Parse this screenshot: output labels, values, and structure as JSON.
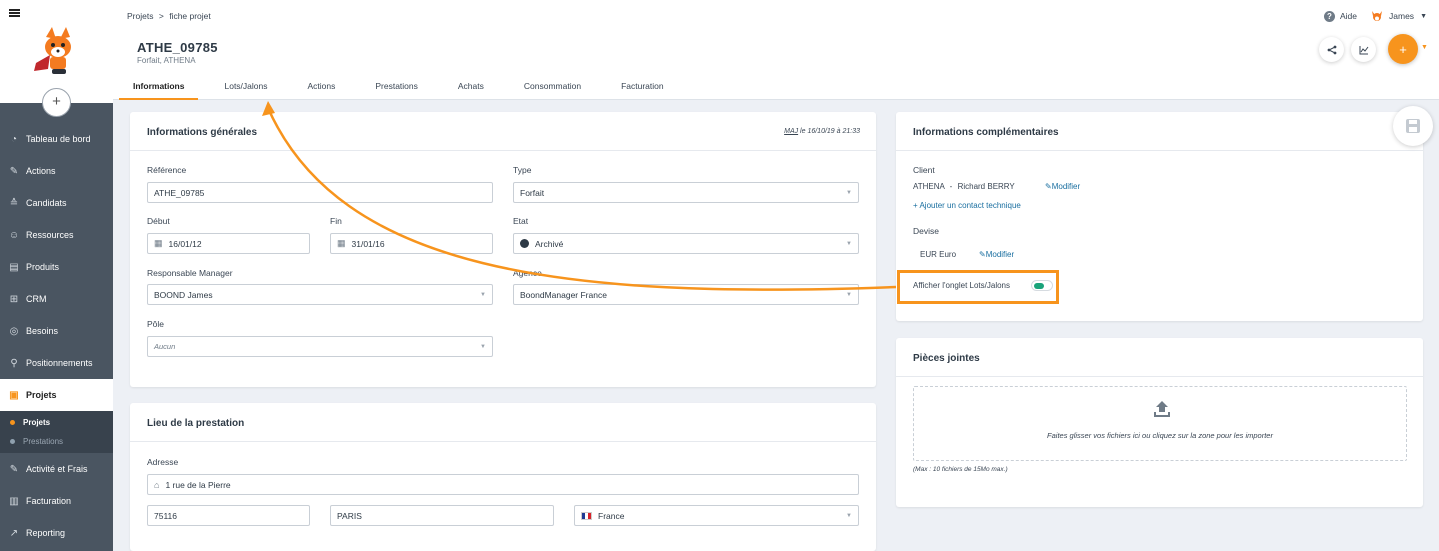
{
  "breadcrumb": {
    "root": "Projets",
    "separator": ">",
    "current": "fiche projet"
  },
  "header": {
    "title": "ATHE_09785",
    "subtitle": "Forfait, ATHENA",
    "help_label": "Aide",
    "user_name": "James",
    "add_label": "+"
  },
  "sidebar": {
    "add_label": "+",
    "items": [
      {
        "label": "Tableau de bord",
        "icon": "dashboard-icon"
      },
      {
        "label": "Actions",
        "icon": "edit-icon"
      },
      {
        "label": "Candidats",
        "icon": "graduation-icon"
      },
      {
        "label": "Ressources",
        "icon": "people-icon"
      },
      {
        "label": "Produits",
        "icon": "product-icon"
      },
      {
        "label": "CRM",
        "icon": "org-chart-icon"
      },
      {
        "label": "Besoins",
        "icon": "target-icon"
      },
      {
        "label": "Positionnements",
        "icon": "pin-icon"
      },
      {
        "label": "Projets",
        "icon": "briefcase-icon",
        "active": true
      },
      {
        "label": "Activité et Frais",
        "icon": "edit-icon"
      },
      {
        "label": "Facturation",
        "icon": "invoice-icon"
      },
      {
        "label": "Reporting",
        "icon": "chart-icon"
      }
    ],
    "sub_items": [
      {
        "label": "Projets",
        "active": true
      },
      {
        "label": "Prestations",
        "active": false
      }
    ]
  },
  "tabs": [
    {
      "label": "Informations",
      "active": true
    },
    {
      "label": "Lots/Jalons"
    },
    {
      "label": "Actions"
    },
    {
      "label": "Prestations"
    },
    {
      "label": "Achats"
    },
    {
      "label": "Consommation"
    },
    {
      "label": "Facturation"
    }
  ],
  "general": {
    "title": "Informations générales",
    "maj_prefix": "MAJ",
    "maj_text": " le 16/10/19 à 21:33",
    "reference_label": "Référence",
    "reference_value": "ATHE_09785",
    "type_label": "Type",
    "type_value": "Forfait",
    "debut_label": "Début",
    "debut_value": "16/01/12",
    "fin_label": "Fin",
    "fin_value": "31/01/16",
    "etat_label": "Etat",
    "etat_value": "Archivé",
    "manager_label": "Responsable Manager",
    "manager_value": "BOOND James",
    "agence_label": "Agence",
    "agence_value": "BoondManager France",
    "pole_label": "Pôle",
    "pole_value": "Aucun"
  },
  "location": {
    "title": "Lieu de la prestation",
    "adresse_label": "Adresse",
    "adresse_value": "1 rue de la Pierre",
    "postcode_value": "75116",
    "city_value": "PARIS",
    "country_value": "France"
  },
  "complementary": {
    "title": "Informations complémentaires",
    "client_label": "Client",
    "client_company": "ATHENA",
    "client_separator": "-",
    "client_contact": "Richard BERRY",
    "modify_label": "Modifier",
    "add_contact_label": "+ Ajouter un contact technique",
    "devise_label": "Devise",
    "devise_value": "EUR Euro",
    "devise_modify_label": "Modifier",
    "toggle_label": "Afficher l'onglet Lots/Jalons",
    "toggle_on": true
  },
  "attachments": {
    "title": "Pièces jointes",
    "dropzone_text": "Faites glisser vos fichiers ici ou cliquez sur la zone pour les importer",
    "note": "(Max : 10 fichiers de 15Mo max.)"
  },
  "colors": {
    "accent": "#f7941d",
    "sidebar": "#4a5561",
    "toggle_on": "#1aa37a",
    "link": "#1a6fa0"
  }
}
